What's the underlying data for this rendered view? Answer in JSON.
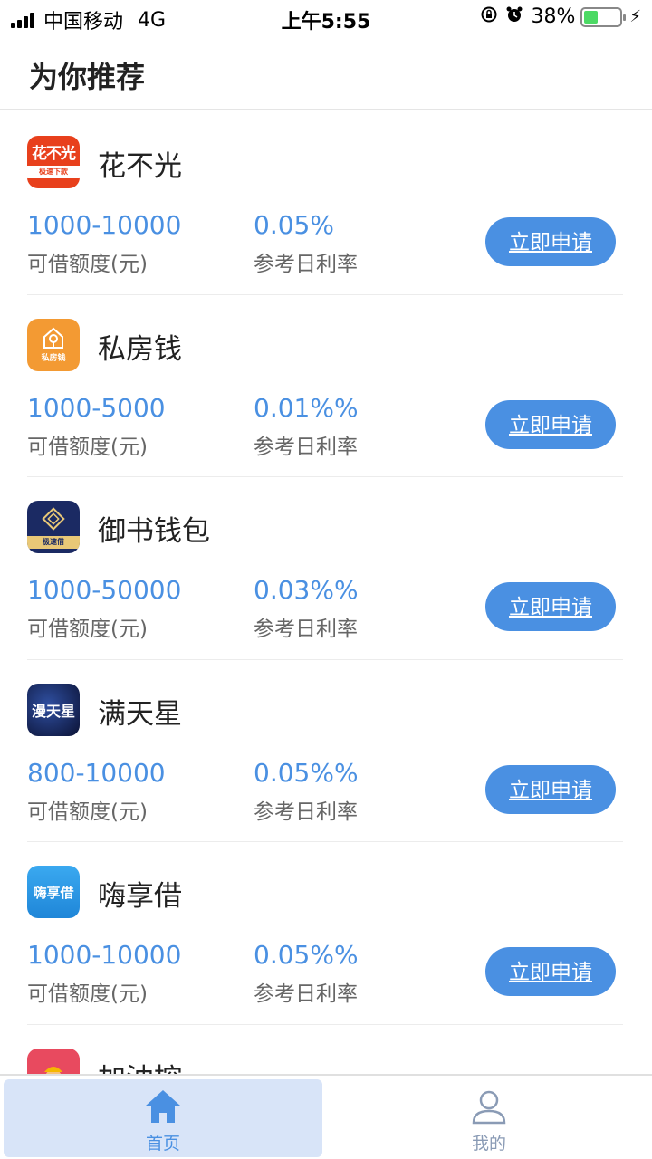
{
  "status_bar": {
    "carrier": "中国移动",
    "network": "4G",
    "time": "上午5:55",
    "battery": "38%",
    "battery_level": 0.38
  },
  "header": {
    "title": "为你推荐"
  },
  "items": [
    {
      "name": "花不光",
      "logo_text": "花不光",
      "logo_sub": "极速下款",
      "amount": "1000-10000",
      "amount_label": "可借额度(元)",
      "rate": "0.05%",
      "rate_label": "参考日利率",
      "button": "立即申请"
    },
    {
      "name": "私房钱",
      "logo_sub": "私房钱",
      "amount": "1000-5000",
      "amount_label": "可借额度(元)",
      "rate": "0.01%%",
      "rate_label": "参考日利率",
      "button": "立即申请"
    },
    {
      "name": "御书钱包",
      "logo_sub": "极速借",
      "amount": "1000-50000",
      "amount_label": "可借额度(元)",
      "rate": "0.03%%",
      "rate_label": "参考日利率",
      "button": "立即申请"
    },
    {
      "name": "满天星",
      "logo_text": "漫天星",
      "amount": "800-10000",
      "amount_label": "可借额度(元)",
      "rate": "0.05%%",
      "rate_label": "参考日利率",
      "button": "立即申请"
    },
    {
      "name": "嗨享借",
      "logo_text": "嗨享借",
      "amount": "1000-10000",
      "amount_label": "可借额度(元)",
      "rate": "0.05%%",
      "rate_label": "参考日利率",
      "button": "立即申请"
    },
    {
      "name": "加油控"
    }
  ],
  "tab_bar": {
    "home": {
      "label": "首页",
      "icon": "home-icon"
    },
    "mine": {
      "label": "我的",
      "icon": "user-icon"
    }
  },
  "colors": {
    "accent": "#4a90e2",
    "tab_active_bg": "#d8e4f8"
  }
}
